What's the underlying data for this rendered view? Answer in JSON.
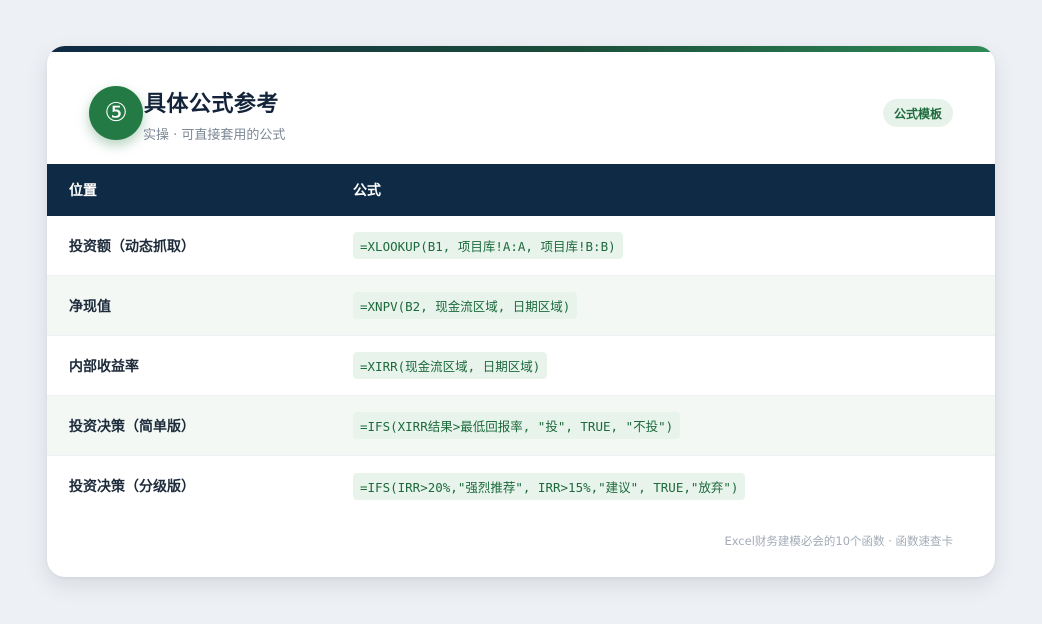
{
  "header": {
    "badge": "⑤",
    "title": "具体公式参考",
    "subtitle": "实操 · 可直接套用的公式",
    "tag": "公式模板"
  },
  "table": {
    "columns": [
      "位置",
      "公式"
    ],
    "rows": [
      {
        "position": "投资额（动态抓取）",
        "formula": "=XLOOKUP(B1, 项目库!A:A, 项目库!B:B)"
      },
      {
        "position": "净现值",
        "formula": "=XNPV(B2, 现金流区域, 日期区域)"
      },
      {
        "position": "内部收益率",
        "formula": "=XIRR(现金流区域, 日期区域)"
      },
      {
        "position": "投资决策（简单版）",
        "formula": "=IFS(XIRR结果>最低回报率, \"投\", TRUE, \"不投\")"
      },
      {
        "position": "投资决策（分级版）",
        "formula": "=IFS(IRR>20%,\"强烈推荐\", IRR>15%,\"建议\", TRUE,\"放弃\")"
      }
    ]
  },
  "footer": {
    "text": "Excel财务建模必会的10个函数 · 函数速查卡"
  },
  "colors": {
    "header_bg": "#0f2a44",
    "accent_green": "#247a45",
    "row_alt": "#f3f8f4"
  }
}
